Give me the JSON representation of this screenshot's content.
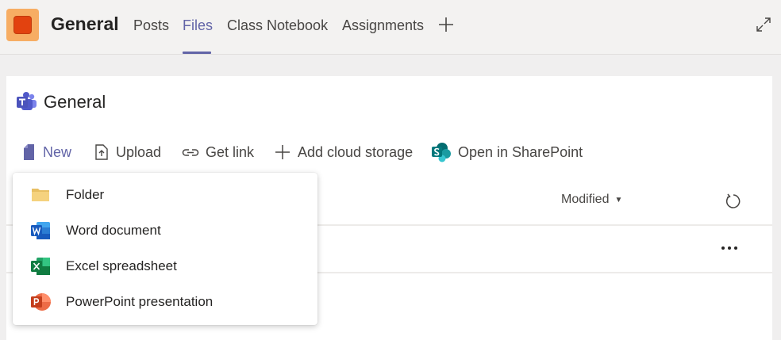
{
  "header": {
    "channel_title": "General",
    "tabs": [
      {
        "label": "Posts"
      },
      {
        "label": "Files"
      },
      {
        "label": "Class Notebook"
      },
      {
        "label": "Assignments"
      }
    ],
    "active_tab": "Files",
    "add_tab_icon": "plus-icon",
    "expand_icon": "expand-icon"
  },
  "files": {
    "title": "General",
    "toolbar": {
      "new_label": "New",
      "upload_label": "Upload",
      "get_link_label": "Get link",
      "add_cloud_label": "Add cloud storage",
      "open_sharepoint_label": "Open in SharePoint"
    },
    "columns": {
      "modified_label": "Modified"
    }
  },
  "new_menu": {
    "items": [
      {
        "label": "Folder",
        "icon": "folder-icon"
      },
      {
        "label": "Word document",
        "icon": "word-icon"
      },
      {
        "label": "Excel spreadsheet",
        "icon": "excel-icon"
      },
      {
        "label": "PowerPoint presentation",
        "icon": "powerpoint-icon"
      }
    ]
  },
  "colors": {
    "accent": "#6264a7",
    "team_avatar_bg": "#f7ad63",
    "team_avatar_fg": "#e2420f"
  }
}
